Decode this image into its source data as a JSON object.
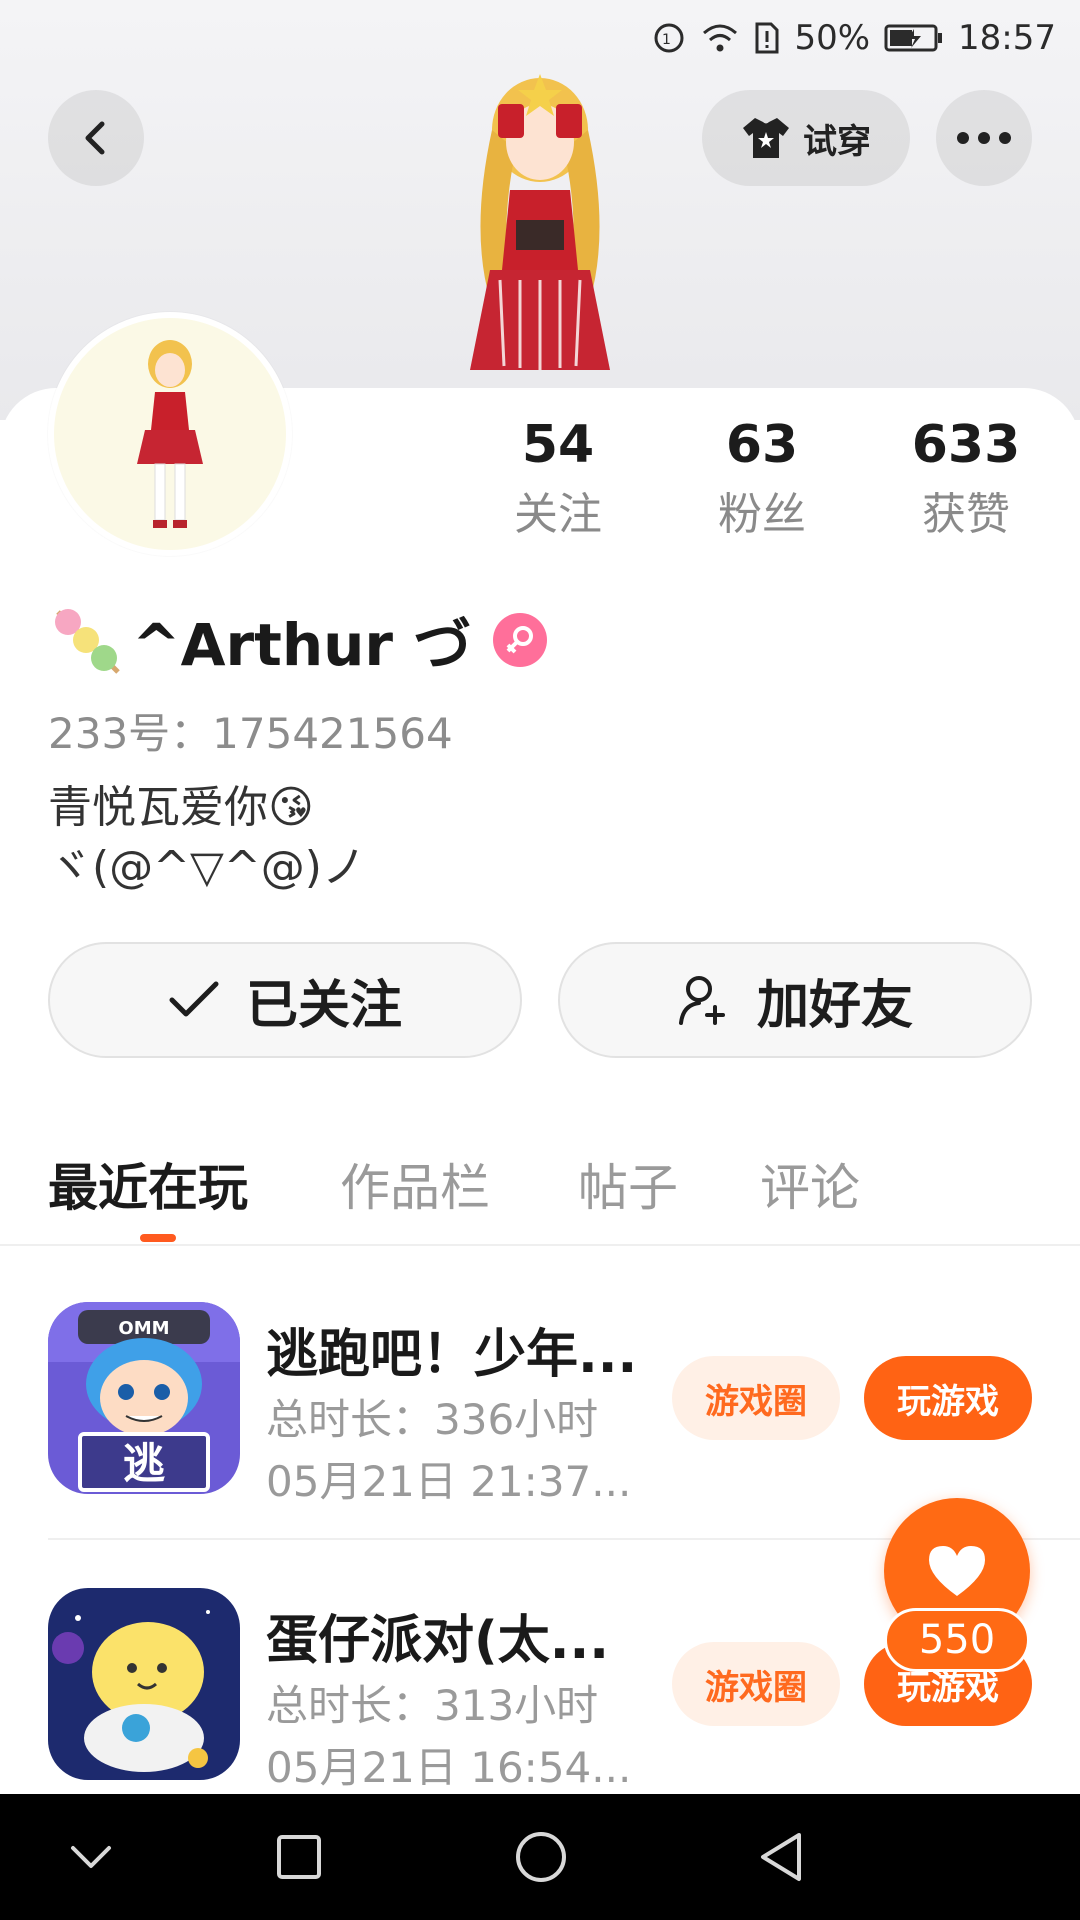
{
  "status_bar": {
    "battery": "50%",
    "time": "18:57"
  },
  "header": {
    "tryon_label": "试穿"
  },
  "stats": [
    {
      "value": "54",
      "label": "关注"
    },
    {
      "value": "63",
      "label": "粉丝"
    },
    {
      "value": "633",
      "label": "获赞"
    }
  ],
  "profile": {
    "name": "^Arthur づ",
    "uid": "233号：175421564",
    "bio_line1": "青悦瓦爱你😘",
    "bio_line2": "ヾ(@^▽^@)ノ"
  },
  "actions": {
    "follow_label": "已关注",
    "add_friend_label": "加好友"
  },
  "tabs": [
    "最近在玩",
    "作品栏",
    "帖子",
    "评论"
  ],
  "games": [
    {
      "title": "逃跑吧！少年...",
      "duration": "总时长：336小时",
      "last_played": "05月21日 21:37...",
      "circle_label": "游戏圈",
      "play_label": "玩游戏",
      "icon_text": "逃"
    },
    {
      "title": "蛋仔派对(太...",
      "duration": "总时长：313小时",
      "last_played": "05月21日 16:54...",
      "circle_label": "游戏圈",
      "play_label": "玩游戏"
    }
  ],
  "like_button": {
    "count": "550"
  },
  "colors": {
    "accent": "#ff6314",
    "accent_light": "#fff0e6",
    "gender": "#ff6f9a"
  }
}
